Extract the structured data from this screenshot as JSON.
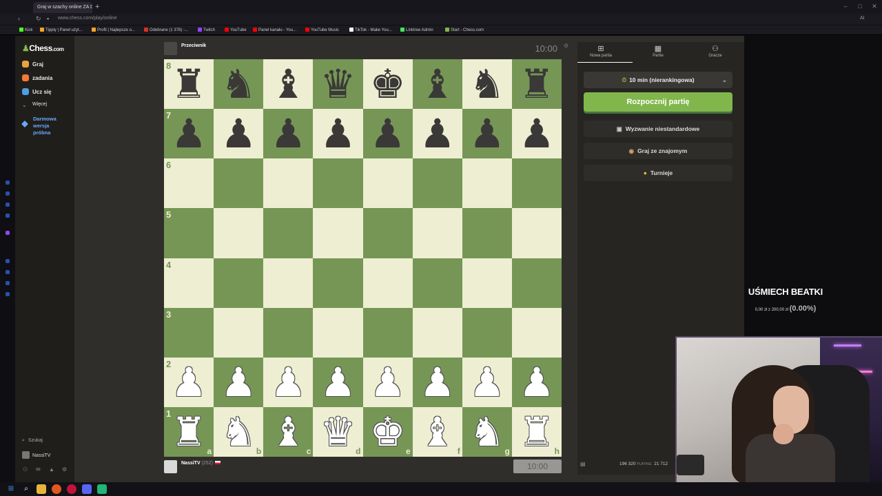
{
  "browser": {
    "tab_title": "Graj w szachy online ZA DARMO",
    "new_tab": "+",
    "url": "www.chess.com/play/online",
    "bookmarks": [
      {
        "label": "Kick",
        "color": "#53fc18"
      },
      {
        "label": "Tipply | Panel użyt...",
        "color": "#f5a623"
      },
      {
        "label": "Profil | Najlepsze o...",
        "color": "#f5a623"
      },
      {
        "label": "Odebrane (1 378) -...",
        "color": "#d93025"
      },
      {
        "label": "Twitch",
        "color": "#9146ff"
      },
      {
        "label": "YouTube",
        "color": "#ff0000"
      },
      {
        "label": "Panel kanału - You...",
        "color": "#ff0000"
      },
      {
        "label": "YouTube Music",
        "color": "#ff0000"
      },
      {
        "label": "TikTok - Make You...",
        "color": "#ffffff"
      },
      {
        "label": "Linktree Admin",
        "color": "#43e55e"
      },
      {
        "label": "Start - Chess.com",
        "color": "#81b64c"
      }
    ],
    "ai_label": "AI"
  },
  "sidebar": {
    "logo": "Chess",
    "logo_suffix": ".com",
    "items": [
      {
        "label": "Graj",
        "icon": "chessboard-icon",
        "color": "#e8a33d"
      },
      {
        "label": "zadania",
        "icon": "puzzle-icon",
        "color": "#f07a3a"
      },
      {
        "label": "Ucz się",
        "icon": "learn-icon",
        "color": "#4b9fe3"
      },
      {
        "label": "Więcej",
        "icon": "chevron-down-icon",
        "color": ""
      }
    ],
    "trial": "Darmowa wersja próbna",
    "search": "Szukaj",
    "user": "NassiTV"
  },
  "game": {
    "opponent": "Przeciwnik",
    "opponent_clock": "10:00",
    "me_name": "NassiTV",
    "me_rating": "(252)",
    "me_clock": "10:00",
    "ranks": [
      "8",
      "7",
      "6",
      "5",
      "4",
      "3",
      "2",
      "1"
    ],
    "files": [
      "a",
      "b",
      "c",
      "d",
      "e",
      "f",
      "g",
      "h"
    ],
    "position": [
      [
        "r",
        "n",
        "b",
        "q",
        "k",
        "b",
        "n",
        "r"
      ],
      [
        "p",
        "p",
        "p",
        "p",
        "p",
        "p",
        "p",
        "p"
      ],
      [
        "",
        "",
        "",
        "",
        "",
        "",
        "",
        ""
      ],
      [
        "",
        "",
        "",
        "",
        "",
        "",
        "",
        ""
      ],
      [
        "",
        "",
        "",
        "",
        "",
        "",
        "",
        ""
      ],
      [
        "",
        "",
        "",
        "",
        "",
        "",
        "",
        ""
      ],
      [
        "P",
        "P",
        "P",
        "P",
        "P",
        "P",
        "P",
        "P"
      ],
      [
        "R",
        "N",
        "B",
        "Q",
        "K",
        "B",
        "N",
        "R"
      ]
    ]
  },
  "panel": {
    "tabs": [
      {
        "label": "Nowa partia",
        "icon": "plus-icon"
      },
      {
        "label": "Partie",
        "icon": "games-icon"
      },
      {
        "label": "Gracze",
        "icon": "players-icon"
      }
    ],
    "time_control": "10 min (nierankingowa)",
    "play_button": "Rozpocznij partię",
    "options": [
      {
        "label": "Wyzwanie niestandardowe",
        "icon": "custom-challenge-icon"
      },
      {
        "label": "Graj ze znajomym",
        "icon": "friend-icon"
      },
      {
        "label": "Turnieje",
        "icon": "trophy-icon"
      }
    ],
    "stats_playing": "196 320",
    "stats_playing_label": "PLAYING",
    "stats_other": "21 712"
  },
  "overlay": {
    "goal_title": "UŚMIECH BEATKI",
    "goal_amount": "0,00 zł z 200,00 zł",
    "goal_percent": "(0.00%)"
  },
  "colors": {
    "light_square": "#eeeed2",
    "dark_square": "#769656",
    "accent": "#81b64c"
  }
}
